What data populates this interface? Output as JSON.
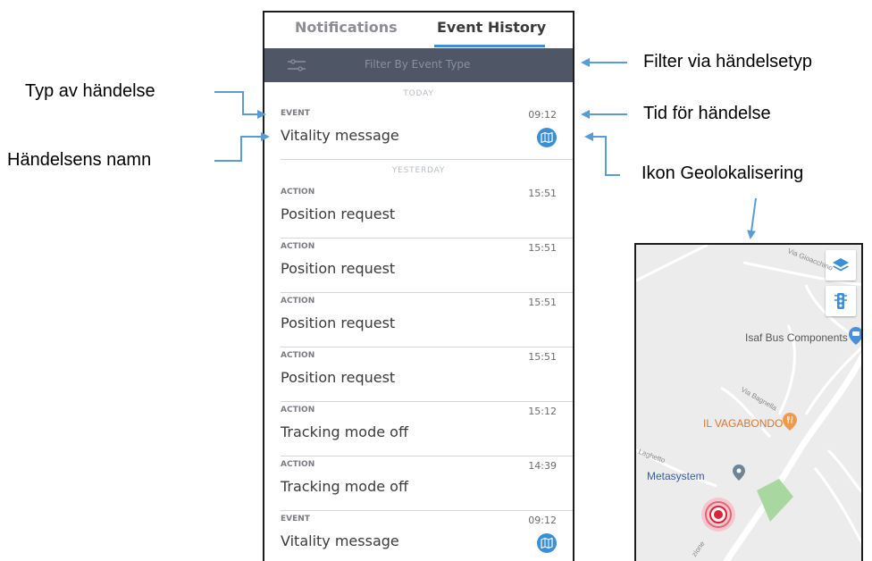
{
  "tabs": [
    {
      "label": "Notifications",
      "active": false
    },
    {
      "label": "Event History",
      "active": true
    }
  ],
  "filter": {
    "label": "Filter By Event Type",
    "icon": "filter-sliders-icon"
  },
  "sections": {
    "today": "TODAY",
    "yesterday": "YESTERDAY"
  },
  "events": [
    {
      "type": "EVENT",
      "time": "09:12",
      "name": "Vitality message",
      "geo_icon": "map-icon"
    },
    {
      "type": "ACTION",
      "time": "15:51",
      "name": "Position request"
    },
    {
      "type": "ACTION",
      "time": "15:51",
      "name": "Position request"
    },
    {
      "type": "ACTION",
      "time": "15:51",
      "name": "Position request"
    },
    {
      "type": "ACTION",
      "time": "15:51",
      "name": "Position request"
    },
    {
      "type": "ACTION",
      "time": "15:12",
      "name": "Tracking mode off"
    },
    {
      "type": "ACTION",
      "time": "14:39",
      "name": "Tracking mode off"
    },
    {
      "type": "EVENT",
      "time": "09:12",
      "name": "Vitality message",
      "geo_icon": "map-icon"
    }
  ],
  "annotations": {
    "filter": "Filter via händelsetyp",
    "time": "Tid för händelse",
    "type": "Typ av händelse",
    "name": "Händelsens namn",
    "geo": "Ikon Geolokalisering"
  },
  "map": {
    "streets": [
      "Via Gioacchino",
      "Via Bagnella",
      "Laghetto",
      "zione"
    ],
    "places": [
      {
        "name": "Isaf Bus Components Srl"
      },
      {
        "name": "IL VAGABONDO"
      },
      {
        "name": "Metasystem"
      }
    ],
    "controls": [
      "layers-icon",
      "traffic-light-icon"
    ]
  },
  "colors": {
    "accent": "#3a8fd6",
    "filter_bar": "#4f5665",
    "arrow": "#5b9bd5",
    "geo_icon": "#3a8fd6",
    "map_pin": "#d9233a",
    "food_pin": "#f0994a"
  }
}
